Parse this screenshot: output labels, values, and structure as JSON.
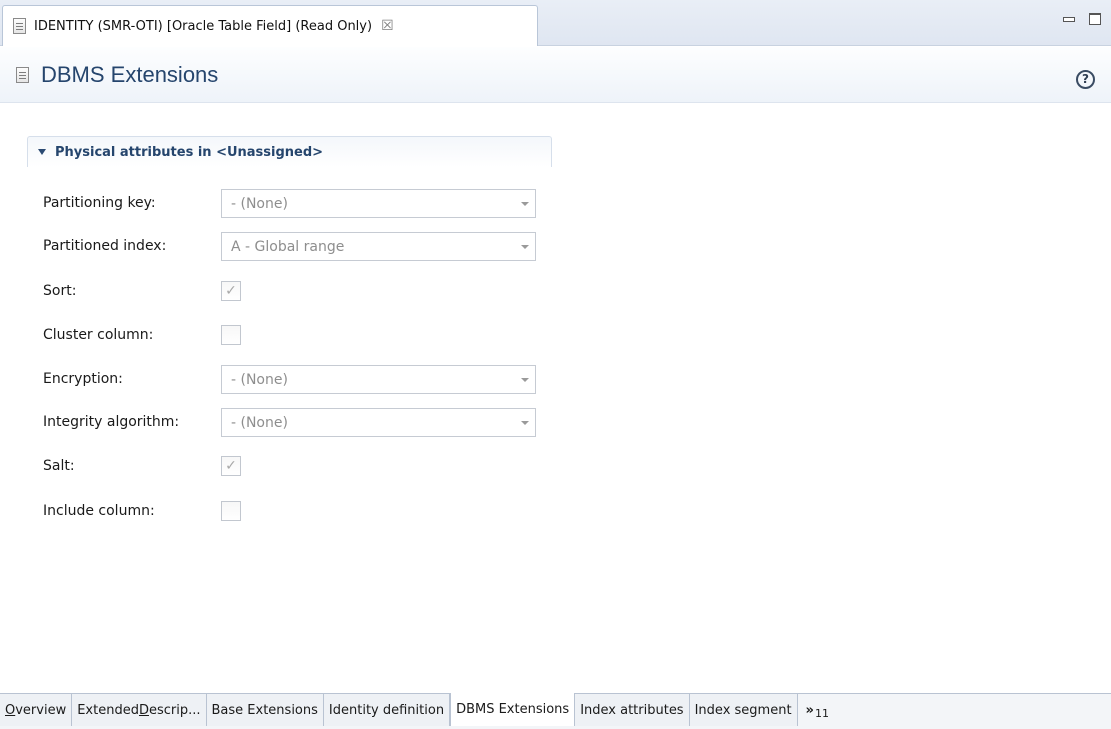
{
  "editor_tab": {
    "title": "IDENTITY (SMR-OTI)  [Oracle Table Field] (Read Only)",
    "close_glyph": "☒"
  },
  "header": {
    "title": "DBMS Extensions",
    "help_glyph": "?"
  },
  "section": {
    "title": "Physical attributes in <Unassigned>"
  },
  "fields": {
    "partitioning_key": {
      "label": "Partitioning key:",
      "value": "- (None)"
    },
    "partitioned_index": {
      "label": "Partitioned index:",
      "value": "A - Global range"
    },
    "sort": {
      "label": "Sort:",
      "checked": true,
      "mark": "✓"
    },
    "cluster_column": {
      "label": "Cluster column:",
      "checked": false,
      "mark": ""
    },
    "encryption": {
      "label": "Encryption:",
      "value": "- (None)"
    },
    "integrity_algorithm": {
      "label": "Integrity algorithm:",
      "value": "- (None)"
    },
    "salt": {
      "label": "Salt:",
      "checked": true,
      "mark": "✓"
    },
    "include_column": {
      "label": "Include column:",
      "checked": false,
      "mark": ""
    }
  },
  "page_tabs": {
    "overview": {
      "mnemonic": "O",
      "rest": "verview"
    },
    "extended": {
      "pre": "Extended ",
      "mnemonic": "D",
      "rest": "escrip..."
    },
    "base_extensions": "Base Extensions",
    "identity_definition": "Identity definition",
    "dbms_extensions": "DBMS Extensions",
    "index_attributes": "Index attributes",
    "index_segment": "Index segment",
    "more_glyph": "»",
    "more_count": "11"
  }
}
